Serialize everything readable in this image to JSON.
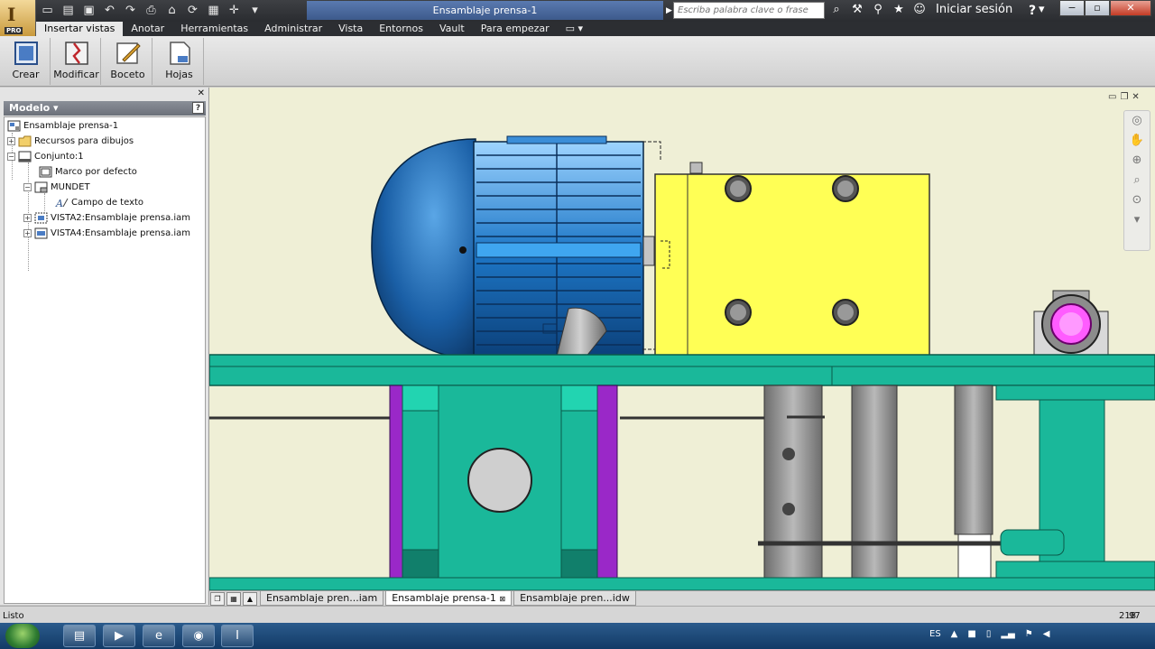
{
  "title_bar": {
    "document_title": "Ensamblaje prensa-1",
    "search_placeholder": "Escriba palabra clave o frase",
    "sign_in_label": "Iniciar sesión",
    "help_label": "?",
    "app_badge": "PRO"
  },
  "ribbon_tabs": [
    {
      "label": "Insertar vistas",
      "active": true
    },
    {
      "label": "Anotar",
      "active": false
    },
    {
      "label": "Herramientas",
      "active": false
    },
    {
      "label": "Administrar",
      "active": false
    },
    {
      "label": "Vista",
      "active": false
    },
    {
      "label": "Entornos",
      "active": false
    },
    {
      "label": "Vault",
      "active": false
    },
    {
      "label": "Para empezar",
      "active": false
    }
  ],
  "ribbon_buttons": [
    {
      "label": "Crear",
      "icon": "create-view-icon"
    },
    {
      "label": "Modificar",
      "icon": "modify-icon"
    },
    {
      "label": "Boceto",
      "icon": "sketch-icon"
    },
    {
      "label": "Hojas",
      "icon": "sheets-icon"
    }
  ],
  "browser": {
    "header": "Modelo",
    "help": "?",
    "nodes": [
      {
        "label": "Ensamblaje prensa-1",
        "icon": "drawing-icon"
      },
      {
        "label": "Recursos para dibujos",
        "icon": "folder-icon",
        "expander": "+"
      },
      {
        "label": "Conjunto:1",
        "icon": "sheet-icon",
        "expander": "−"
      },
      {
        "label": "Marco por defecto",
        "icon": "frame-icon"
      },
      {
        "label": "MUNDET",
        "icon": "title-block-icon",
        "expander": "−"
      },
      {
        "label": "Campo de texto",
        "icon": "text-field-icon"
      },
      {
        "label": "VISTA2:Ensamblaje prensa.iam",
        "icon": "view-icon",
        "expander": "+"
      },
      {
        "label": "VISTA4:Ensamblaje prensa.iam",
        "icon": "view-icon",
        "expander": "+"
      }
    ]
  },
  "doc_tabs": [
    {
      "label": "Ensamblaje pren...iam",
      "active": false
    },
    {
      "label": "Ensamblaje prensa-1",
      "active": true,
      "close": "⊠"
    },
    {
      "label": "Ensamblaje pren...idw",
      "active": false
    }
  ],
  "status": {
    "text": "Listo",
    "value_a": "218",
    "value_b": "97"
  },
  "taskbar": {
    "language": "ES"
  },
  "colors": {
    "motor_blue": "#1e78c8",
    "housing_yellow": "#ffff55",
    "frame_teal": "#1ab89a",
    "support_purple": "#9a28c8",
    "canvas_bg": "#efefd6"
  }
}
